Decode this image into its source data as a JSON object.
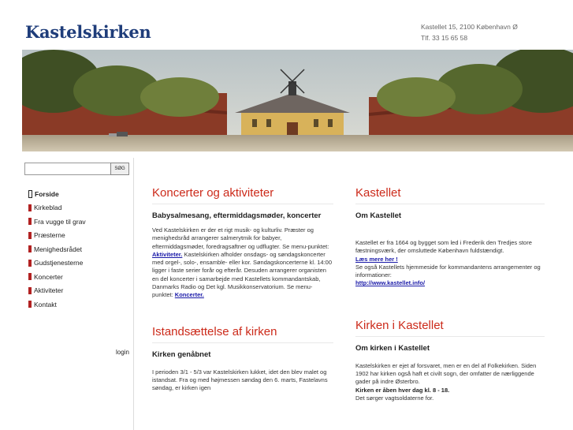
{
  "site": {
    "title": "Kastelskirken",
    "address_line1": "Kastellet 15, 2100 København Ø",
    "address_line2": "Tlf. 33 15 65 58"
  },
  "search": {
    "value": "",
    "button_label": "SØG"
  },
  "nav": {
    "items": [
      {
        "label": "Forside",
        "active": true
      },
      {
        "label": "Kirkeblad",
        "active": false
      },
      {
        "label": "Fra vugge til grav",
        "active": false
      },
      {
        "label": "Præsterne",
        "active": false
      },
      {
        "label": "Menighedsrådet",
        "active": false
      },
      {
        "label": "Gudstjenesterne",
        "active": false
      },
      {
        "label": "Koncerter",
        "active": false
      },
      {
        "label": "Aktiviteter",
        "active": false
      },
      {
        "label": "Kontakt",
        "active": false
      }
    ],
    "login_label": "login"
  },
  "main": {
    "section1": {
      "title": "Koncerter og aktiviteter",
      "subtitle": "Babysalmesang, eftermiddagsmøder, koncerter",
      "text_before_link1": "Ved Kastelskirken er der et rigt musik- og kulturliv. Præster og menighedsråd arrangerer salmerytmik for babyer, eftermiddagsmøder, foredragsaftner og udflugter. Se menu-punktet: ",
      "link1": "Aktiviteter.",
      "text_between_links": " Kastelskirken afholder onsdags- og søndagskoncerter med orgel-, solo-, ensamble- eller kor. Søndagskoncerterne kl. 14:00 ligger i faste serier forår og efterår. Desuden arrangerer organisten en del koncerter i samarbejde med Kastellets kommandantskab, Danmarks Radio og Det kgl. Musikkonservatorium. Se menu-punktet: ",
      "link2": "Koncerter."
    },
    "section2": {
      "title": "Istandsættelse af kirken",
      "subtitle": "Kirken genåbnet",
      "text": "I perioden 3/1 - 5/3 var Kastelskirken lukket, idet den blev malet og istandsat. Fra og med højmessen søndag den 6. marts, Fastelavns søndag, er kirken igen"
    }
  },
  "side": {
    "section1": {
      "title": "Kastellet",
      "subtitle": "Om Kastellet",
      "text1": "Kastellet er fra 1664 og bygget som led i Frederik den Tredjes store fæstningsværk, der omsluttede København fuldstændigt.",
      "link1": "Læs mere her !",
      "text2": "Se også Kastellets hjemmeside for kommandantens arrangementer og informationer:",
      "link2": "http://www.kastellet.info/"
    },
    "section2": {
      "title": "Kirken i Kastellet",
      "subtitle": "Om kirken i Kastellet",
      "text1": "Kastelskirken er ejet af forsvaret, men er en del af Folkekirken. Siden 1902 har kirken også haft et civilt sogn, der omfatter de nærliggende gader på indre Østerbro.",
      "bold": "Kirken er åben hver dag kl. 8 - 18.",
      "text2": "Det sørger vagtsoldaterne for."
    }
  },
  "colors": {
    "title_blue": "#1f3d7a",
    "heading_red": "#cc2a1a",
    "nav_marker": "#b22222",
    "link_blue": "#1a1aa8"
  }
}
